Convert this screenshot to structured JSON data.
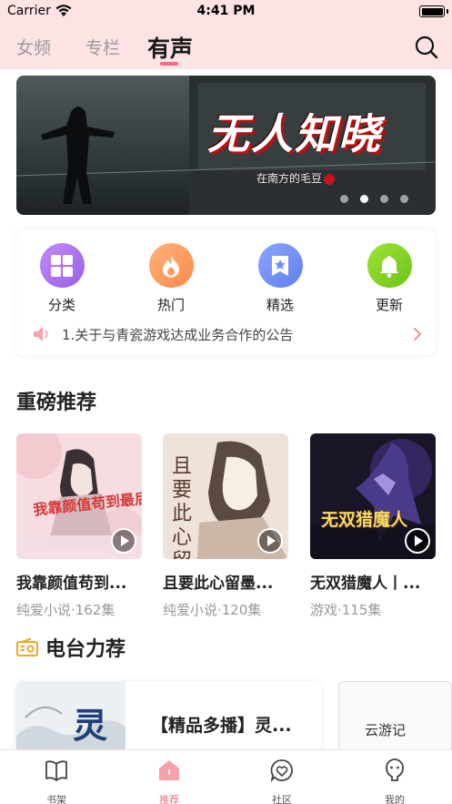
{
  "status_bar": {
    "carrier": "Carrier",
    "time": "4:41 PM"
  },
  "nav": {
    "tabs": [
      "女频",
      "专栏",
      "有声"
    ],
    "active_tab": "有声",
    "search_icon": "search-icon"
  },
  "banner": {
    "title": "无人知晓",
    "subtitle": "在南方的毛豆",
    "dot_count": 4,
    "active_dot": 2
  },
  "categories": [
    {
      "label": "分类",
      "icon": "grid-icon",
      "color": "#a874f0"
    },
    {
      "label": "热门",
      "icon": "flame-icon",
      "color": "#ff9a5c"
    },
    {
      "label": "精选",
      "icon": "bookmark-star-icon",
      "color": "#6f8ef5"
    },
    {
      "label": "更新",
      "icon": "bell-icon",
      "color": "#84d420"
    }
  ],
  "notice": {
    "text": "1.关于与青瓷游戏达成业务合作的公告",
    "icon": "speaker-icon"
  },
  "featured": {
    "title": "重磅推荐",
    "books": [
      {
        "title": "我靠颜值苟到...",
        "meta": "纯爱小说·162集",
        "cover_text": "我靠颜值苟到最后"
      },
      {
        "title": "且要此心留墨...",
        "meta": "纯爱小说·120集",
        "cover_text": "且要此心留墨白"
      },
      {
        "title": "无双猎魔人丨...",
        "meta": "游戏·115集",
        "cover_text": "无双猎魔人"
      }
    ]
  },
  "radio": {
    "title": "电台力荐",
    "card_title": "【精品多播】灵...",
    "thumb_text": "灵",
    "thumb2_text": "云游记"
  },
  "tabbar": {
    "items": [
      {
        "label": "书架",
        "icon": "book-icon"
      },
      {
        "label": "推荐",
        "icon": "home-icon"
      },
      {
        "label": "社区",
        "icon": "heart-chat-icon"
      },
      {
        "label": "我的",
        "icon": "profile-icon"
      }
    ],
    "active": "推荐"
  },
  "colors": {
    "accent": "#f46a80",
    "header_bg": "#fde3e3"
  }
}
